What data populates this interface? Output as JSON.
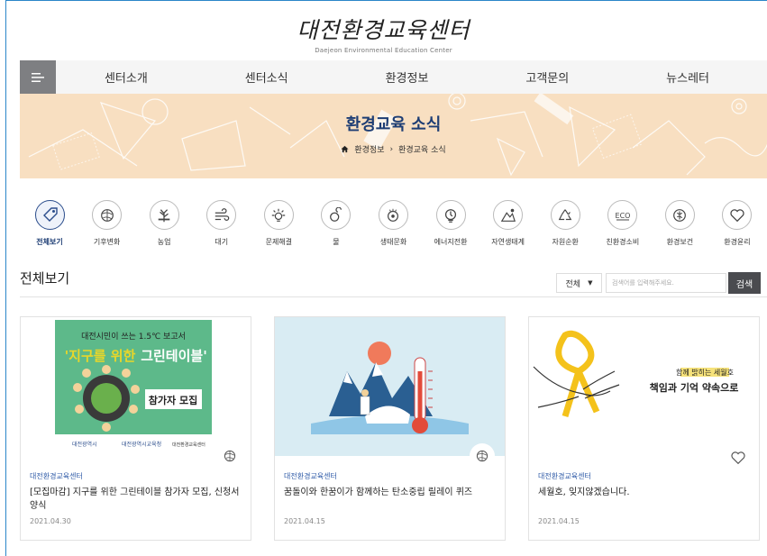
{
  "header": {
    "logo_text": "대전환경교육센터",
    "logo_subtitle": "Daejeon Environmental Education Center"
  },
  "nav": {
    "items": [
      {
        "label": "센터소개"
      },
      {
        "label": "센터소식"
      },
      {
        "label": "환경정보"
      },
      {
        "label": "고객문의"
      },
      {
        "label": "뉴스레터"
      }
    ]
  },
  "banner": {
    "title": "환경교육 소식",
    "breadcrumb": [
      "환경정보",
      "환경교육 소식"
    ],
    "bg_color": "#f8dfc1",
    "title_color": "#1d3d74"
  },
  "categories": [
    {
      "label": "전체보기",
      "icon": "tag-icon",
      "active": true
    },
    {
      "label": "기후변화",
      "icon": "climate-icon"
    },
    {
      "label": "농업",
      "icon": "agriculture-icon"
    },
    {
      "label": "대기",
      "icon": "wind-icon"
    },
    {
      "label": "문제해결",
      "icon": "problem-solving-icon"
    },
    {
      "label": "물",
      "icon": "water-icon"
    },
    {
      "label": "생태문화",
      "icon": "eco-culture-icon"
    },
    {
      "label": "에너지전환",
      "icon": "energy-icon"
    },
    {
      "label": "자연생태계",
      "icon": "ecosystem-icon"
    },
    {
      "label": "자원순환",
      "icon": "recycle-icon"
    },
    {
      "label": "친환경소비",
      "icon": "eco-icon"
    },
    {
      "label": "환경보건",
      "icon": "health-icon"
    },
    {
      "label": "환경윤리",
      "icon": "heart-icon"
    }
  ],
  "section": {
    "title": "전체보기",
    "filter_value": "전체",
    "search_placeholder": "검색어를 입력해주세요.",
    "search_label": "검색"
  },
  "cards": [
    {
      "source": "대전환경교육센터",
      "title": "[모집마감] 지구를 위한 그린테이블 참가자 모집, 신청서 양식",
      "date": "2021.04.30",
      "image_text": {
        "line1": "대전시민이 쓰는 1.5℃ 보고서",
        "line2a": "'지구를 위한",
        "line2b": "그린테이블'",
        "recruit": "참가자 모집",
        "org1": "대전광역시",
        "org2": "대전광역시교육청",
        "org3": "대전환경교육센터"
      }
    },
    {
      "source": "대전환경교육센터",
      "title": "꿈돌이와 한꿈이가 함께하는 탄소중립 릴레이 퀴즈",
      "date": "2021.04.15"
    },
    {
      "source": "대전환경교육센터",
      "title": "세월호, 잊지않겠습니다.",
      "date": "2021.04.15",
      "image_text": {
        "small": "함께 밝히는 세월호",
        "big": "책임과 기억 약속으로"
      }
    }
  ],
  "colors": {
    "accent": "#2e5aa7",
    "nav_bg": "#f5f5f5",
    "menu_btn": "#7e7f82",
    "search_btn": "#4a4b4f"
  }
}
